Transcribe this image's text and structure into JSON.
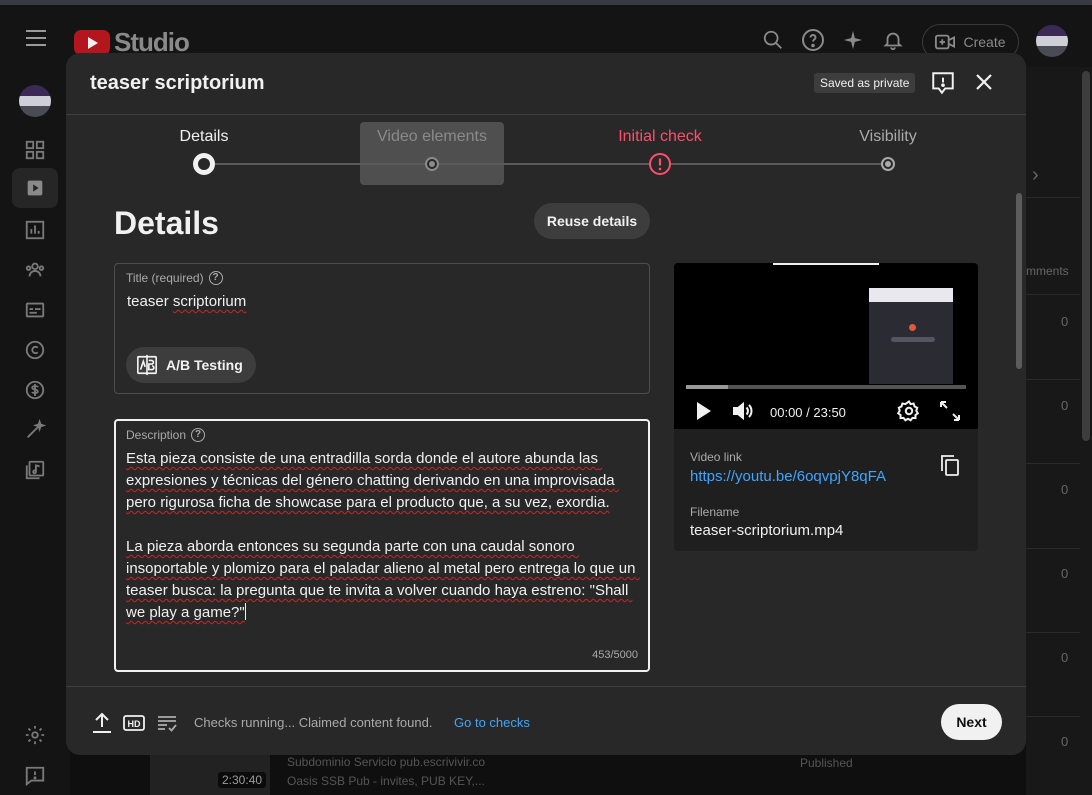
{
  "app": {
    "brand": "Studio",
    "create_label": "Create"
  },
  "modal": {
    "title": "teaser scriptorium",
    "saved_status": "Saved as private"
  },
  "stepper": {
    "steps": [
      {
        "label": "Details",
        "state": "current"
      },
      {
        "label": "Video elements",
        "state": "pending"
      },
      {
        "label": "Initial check",
        "state": "error"
      },
      {
        "label": "Visibility",
        "state": "pending"
      }
    ]
  },
  "details": {
    "heading": "Details",
    "reuse_label": "Reuse details",
    "title_field": {
      "label": "Title (required)",
      "value_plain": "teaser ",
      "value_flagged": "scriptorium"
    },
    "ab_testing_label": "A/B Testing",
    "description_field": {
      "label": "Description",
      "paragraph_1": "Esta pieza consiste de una entradilla sorda donde el autore abunda las expresiones y técnicas del género chatting derivando en una improvisada pero rigurosa ficha de showcase para el producto que, a su vez, exordia.",
      "paragraph_2": "La pieza aborda entonces su segunda parte con una caudal sonoro insoportable y plomizo para el paladar alieno al metal pero entrega lo que un teaser busca: la pregunta que te invita a volver cuando haya estreno: \"Shall we play a game?\"",
      "counter": "453/5000"
    }
  },
  "video": {
    "time": "00:00 / 23:50",
    "progress_fraction": 0.15,
    "link_label": "Video link",
    "link_url": "https://youtu.be/6oqvpjY8qFA",
    "filename_label": "Filename",
    "filename": "teaser-scriptorium.mp4"
  },
  "footer": {
    "status": "Checks running... Claimed content found.",
    "checks_link": "Go to checks",
    "next_label": "Next"
  },
  "background": {
    "column_header": "mments",
    "row_values": [
      "0",
      "0",
      "0",
      "0",
      "0",
      "0"
    ],
    "row_duration": "2:30:40",
    "row_title": "Subdominio Servicio pub.escrivivir.co",
    "row_desc": "Oasis SSB Pub - invites, PUB KEY,...",
    "row_status": "Published"
  },
  "colors": {
    "error": "#ff4e6a",
    "link": "#3ea6ff",
    "surface": "#282828"
  }
}
